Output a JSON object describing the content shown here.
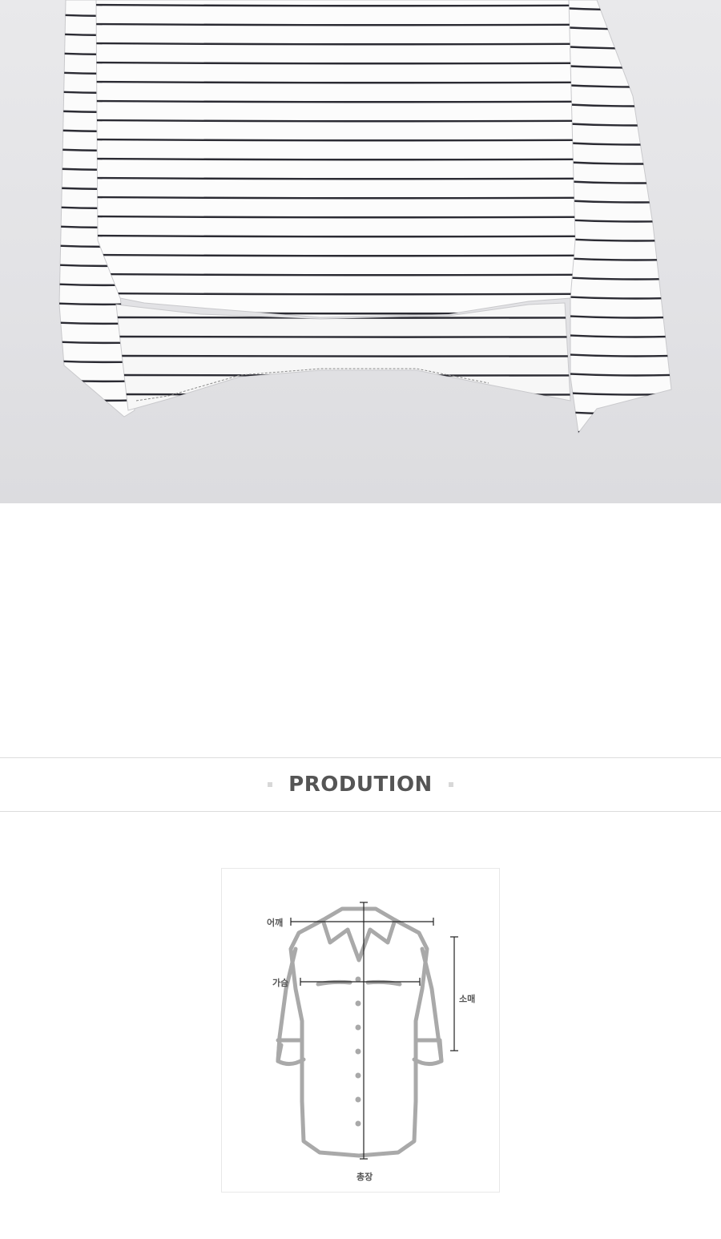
{
  "product_photo": {
    "subject": "white-black-striped-long-sleeve-tee"
  },
  "section": {
    "title": "PRODUTION"
  },
  "size_diagram": {
    "labels": {
      "shoulder": "어깨",
      "chest": "가슴",
      "sleeve": "소매",
      "length": "총장"
    }
  },
  "colors": {
    "stripe": "#2b2b33",
    "fabric": "#fbfbfb",
    "backdrop": "#e4e4e7",
    "outline": "#a9a9a9",
    "measure_line": "#222222",
    "title_text": "#555555"
  }
}
